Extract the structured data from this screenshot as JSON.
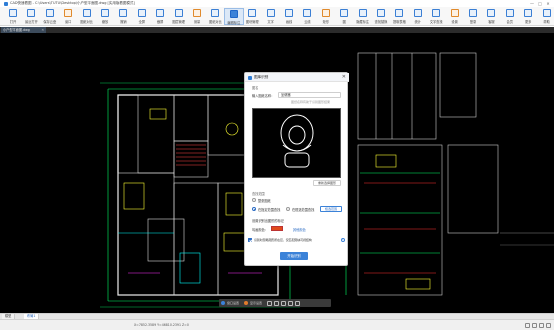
{
  "window": {
    "title": "CAD快速看图 - C:\\Users\\TUTU\\Desktop\\小户型平面图.dwg [实用版看图模式]",
    "controls": [
      "—",
      "□",
      "✕"
    ]
  },
  "ribbon": {
    "tools": [
      {
        "label": "打开",
        "icon": "open-icon"
      },
      {
        "label": "最近打开",
        "icon": "recent-icon"
      },
      {
        "label": "保存云盘",
        "icon": "cloud-save-icon"
      },
      {
        "label": "窗口",
        "icon": "window-icon"
      },
      {
        "label": "图纸对比",
        "icon": "compare-icon"
      },
      {
        "label": "缩放",
        "icon": "zoom-icon"
      },
      {
        "label": "撤销",
        "icon": "undo-icon"
      },
      {
        "label": "全屏",
        "icon": "fullscreen-icon"
      },
      {
        "label": "截屏",
        "icon": "screenshot-icon"
      },
      {
        "label": "图层管理",
        "icon": "layer-icon"
      },
      {
        "label": "测量",
        "icon": "measure-icon"
      },
      {
        "label": "图纸对比",
        "icon": "diff-icon"
      },
      {
        "label": "编辑标注",
        "icon": "annotate-icon",
        "selected": true
      },
      {
        "label": "图块管理",
        "icon": "block-icon"
      },
      {
        "label": "文字",
        "icon": "text-icon"
      },
      {
        "label": "画线",
        "icon": "line-icon"
      },
      {
        "label": "云线",
        "icon": "cloud-line-icon"
      },
      {
        "label": "矩形",
        "icon": "rect-icon"
      },
      {
        "label": "圆",
        "icon": "circle-icon"
      },
      {
        "label": "隐藏标注",
        "icon": "hide-icon"
      },
      {
        "label": "查找替换",
        "icon": "search-icon"
      },
      {
        "label": "提取表格",
        "icon": "table-icon"
      },
      {
        "label": "统计",
        "icon": "stat-icon"
      },
      {
        "label": "文字查找",
        "icon": "find-text-icon"
      },
      {
        "label": "设置",
        "icon": "settings-icon"
      },
      {
        "label": "登录",
        "icon": "login-icon"
      },
      {
        "label": "客服",
        "icon": "service-icon"
      },
      {
        "label": "会员",
        "icon": "vip-icon"
      },
      {
        "label": "更多",
        "icon": "more-icon"
      },
      {
        "label": "帮助",
        "icon": "help-icon"
      }
    ]
  },
  "doc_tab": {
    "label": "小户型平面图.dwg",
    "close": "✕"
  },
  "dialog": {
    "title": "图库识别",
    "close": "✕",
    "section_name": "图名",
    "name_label": "输入图纸名称：",
    "name_value": "坐便器",
    "name_hint": "图纸名称有助于识别图形结果",
    "reselect_button": "重新选择图形",
    "section_range": "查找范围",
    "radio_current": "整张图纸",
    "radio_view": "在指定范围查找",
    "radio_region": "在框选范围查找",
    "region_button": "框选范围",
    "section_mark": "设置识别出图形的标记",
    "mark_color_label": "勾画颜色：",
    "mark_color": "#e04a1a",
    "mark_color_hint": "其他颜色",
    "checkbox_label": "识别时忽略图形所在层，仅匹配图块可视结构",
    "help_icon": "?",
    "start_button": "开始识别"
  },
  "canvas_toolbar": {
    "items": [
      "窗口设置",
      "显示设置"
    ]
  },
  "layout_tabs": [
    {
      "label": "模型",
      "active": false
    },
    {
      "label": "布局1",
      "active": true
    }
  ],
  "status": {
    "coordinates": "X=7852.3589 Y=46810.2391 Z=0"
  }
}
